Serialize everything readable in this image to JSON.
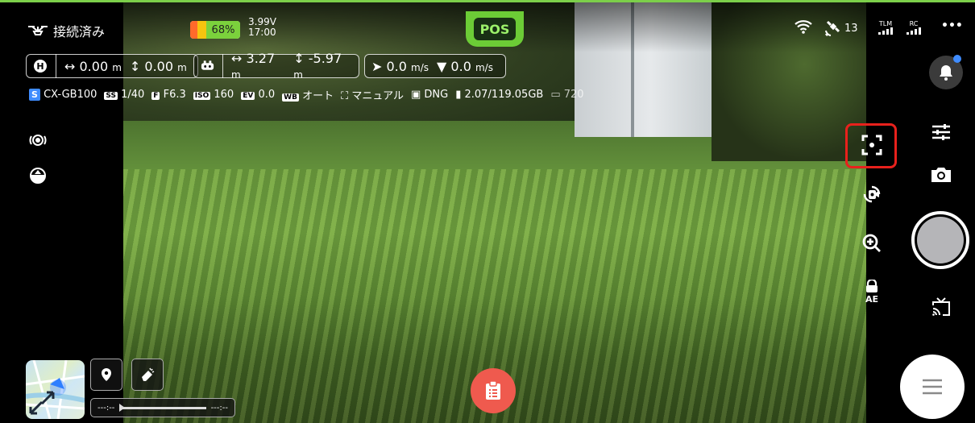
{
  "status": {
    "connection": "接続済み",
    "battery_percent_label": "68%",
    "battery_level": 0.68,
    "voltage": "3.99V",
    "time": "17:00",
    "mode": "POS",
    "gps_count": "13",
    "tlm_label": "TLM",
    "rc_label": "RC",
    "more": "•••"
  },
  "telemetry": {
    "home_dist": "↔ 0.00",
    "home_dist_unit": "m",
    "home_height": "↕ 0.00",
    "home_height_unit": "m",
    "drone_dist": "↔ 3.27",
    "drone_dist_unit": "m",
    "drone_height": "↕ -5.97",
    "drone_height_unit": "m",
    "hspeed": "0.0",
    "hspeed_unit": "m/s",
    "vspeed": "0.0",
    "vspeed_unit": "m/s"
  },
  "camera_info": {
    "camera": "CX-GB100",
    "ss_tag": "SS",
    "ss": "1/40",
    "f_tag": "F",
    "f": "F6.3",
    "iso_tag": "ISO",
    "iso": "160",
    "ev_tag": "EV",
    "ev": "0.0",
    "wb_tag": "WB",
    "wb": "オート",
    "focus": "マニュアル",
    "format": "DNG",
    "storage": "2.07/119.05GB",
    "resolution": "720"
  },
  "timeline": {
    "start": "---:--",
    "end": "---:--"
  },
  "colors": {
    "accent_green": "#6ccc36",
    "highlight_red": "#e8211c",
    "report_red": "#ef5a4e",
    "notify_blue": "#3f8cff"
  },
  "icons": [
    "drone-icon",
    "wifi-icon",
    "satellite-icon",
    "bell-icon",
    "focus-icon",
    "camera-switch-icon",
    "sliders-icon",
    "camera-icon",
    "zoom-icon",
    "ae-lock-icon",
    "cast-icon",
    "menu-icon",
    "clipboard-icon",
    "location-pin-icon",
    "eraser-icon",
    "home-icon",
    "sensor-icon",
    "gimbal-icon"
  ]
}
